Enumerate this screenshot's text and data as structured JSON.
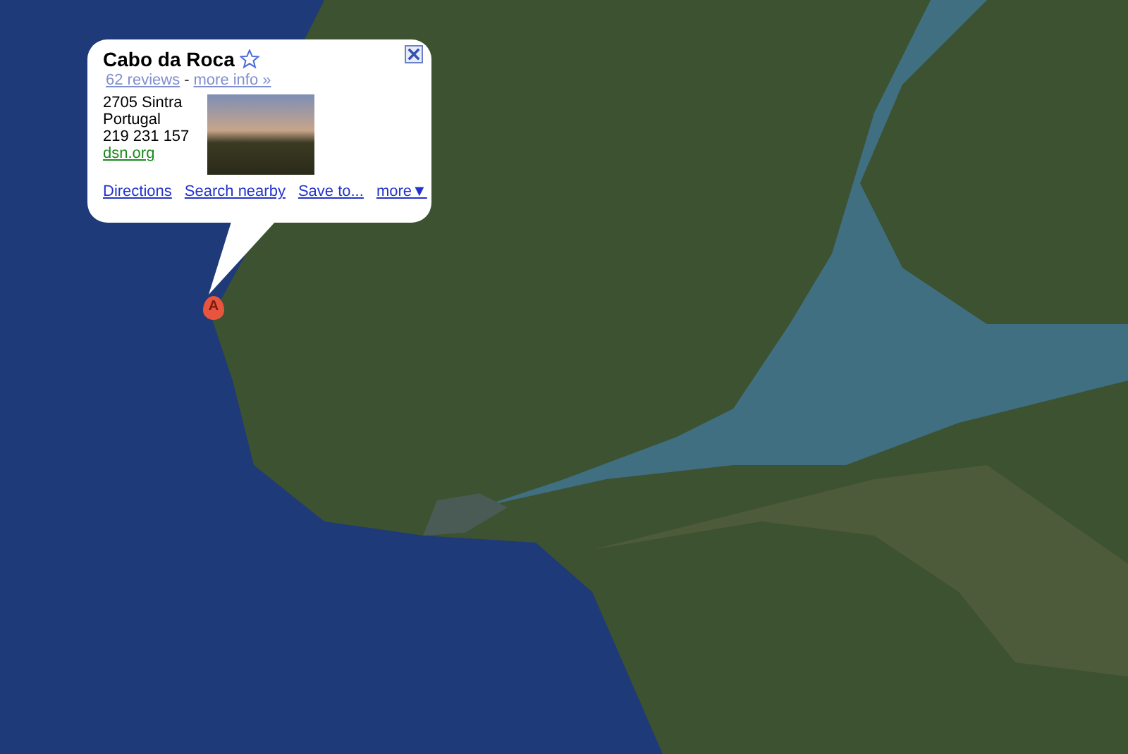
{
  "marker": {
    "label": "A"
  },
  "info_window": {
    "title": "Cabo da Roca",
    "starred": false,
    "reviews": "62 reviews",
    "separator": "-",
    "more_info": "more info »",
    "address": [
      "2705 Sintra",
      "Portugal",
      "219 231 157"
    ],
    "website": "dsn.org",
    "actions": [
      "Directions",
      "Search nearby",
      "Save to...",
      "more▼"
    ]
  }
}
